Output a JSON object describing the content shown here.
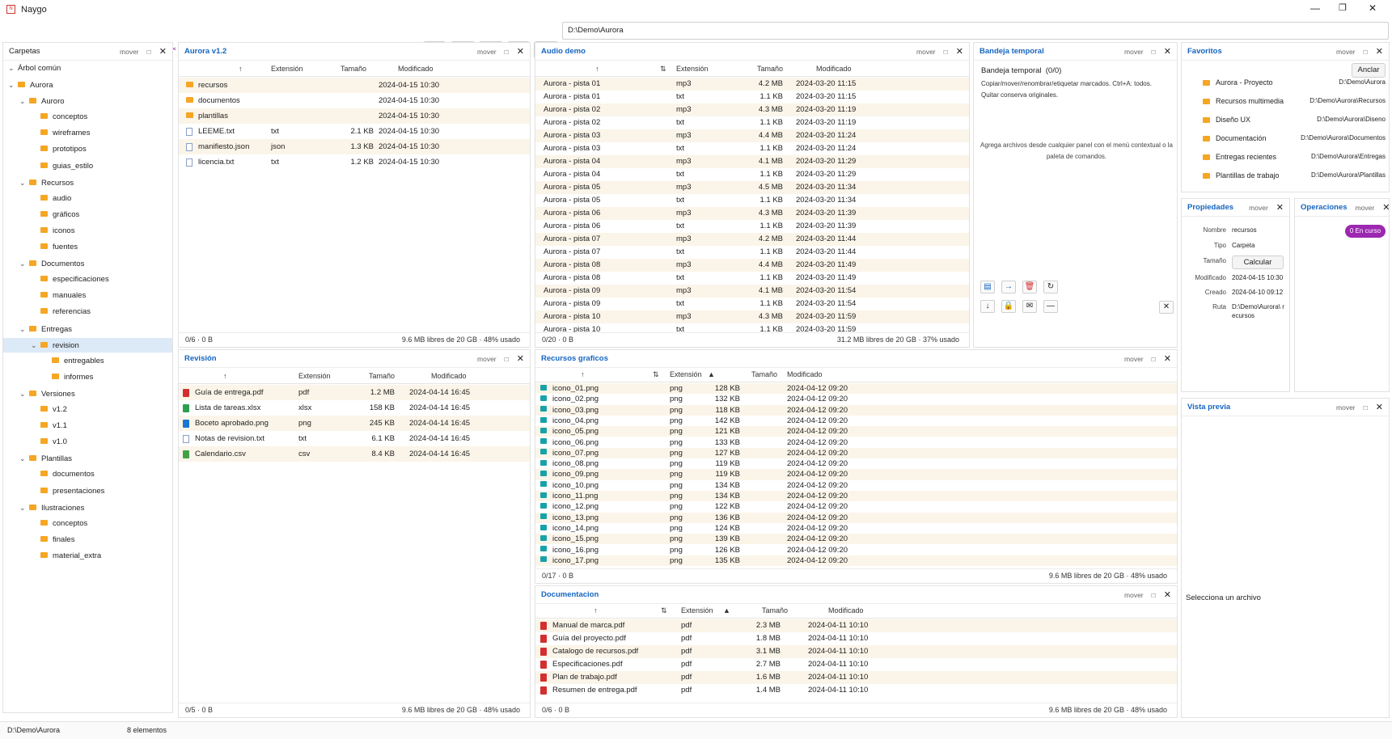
{
  "app": {
    "title": "Naygo"
  },
  "toolbar": {
    "path": "D:\\Demo\\Aurora"
  },
  "status": {
    "path": "D:\\Demo\\Aurora",
    "count": "8 elementos"
  },
  "pane_common": {
    "move": "mover",
    "restore": "□",
    "close": "✕"
  },
  "carpetas": {
    "title": "Carpetas",
    "tree_root": "Árbol común",
    "items": [
      {
        "label": "Aurora",
        "level": 0,
        "chev": "⌄"
      },
      {
        "label": "Auroro",
        "level": 1,
        "chev": "⌄"
      },
      {
        "label": "conceptos",
        "level": 2,
        "chev": ""
      },
      {
        "label": "wireframes",
        "level": 2,
        "chev": ""
      },
      {
        "label": "prototipos",
        "level": 2,
        "chev": ""
      },
      {
        "label": "guias_estilo",
        "level": 2,
        "chev": ""
      },
      {
        "label": "Recursos",
        "level": 1,
        "chev": "⌄"
      },
      {
        "label": "audio",
        "level": 2,
        "chev": ""
      },
      {
        "label": "gráficos",
        "level": 2,
        "chev": ""
      },
      {
        "label": "iconos",
        "level": 2,
        "chev": ""
      },
      {
        "label": "fuentes",
        "level": 2,
        "chev": ""
      },
      {
        "label": "Documentos",
        "level": 1,
        "chev": "⌄"
      },
      {
        "label": "especificaciones",
        "level": 2,
        "chev": ""
      },
      {
        "label": "manuales",
        "level": 2,
        "chev": ""
      },
      {
        "label": "referencias",
        "level": 2,
        "chev": ""
      },
      {
        "label": "Entregas",
        "level": 1,
        "chev": "⌄"
      },
      {
        "label": "revision",
        "level": 2,
        "chev": "⌄",
        "selected": true
      },
      {
        "label": "entregables",
        "level": 3,
        "chev": ""
      },
      {
        "label": "informes",
        "level": 3,
        "chev": ""
      },
      {
        "label": "Versiones",
        "level": 1,
        "chev": "⌄"
      },
      {
        "label": "v1.2",
        "level": 2,
        "chev": ""
      },
      {
        "label": "v1.1",
        "level": 2,
        "chev": ""
      },
      {
        "label": "v1.0",
        "level": 2,
        "chev": ""
      },
      {
        "label": "Plantillas",
        "level": 1,
        "chev": "⌄"
      },
      {
        "label": "documentos",
        "level": 2,
        "chev": ""
      },
      {
        "label": "presentaciones",
        "level": 2,
        "chev": ""
      },
      {
        "label": "Ilustraciones",
        "level": 1,
        "chev": "⌄"
      },
      {
        "label": "conceptos",
        "level": 2,
        "chev": ""
      },
      {
        "label": "finales",
        "level": 2,
        "chev": ""
      },
      {
        "label": "material_extra",
        "level": 2,
        "chev": ""
      }
    ]
  },
  "aurora": {
    "title": "Aurora v1.2",
    "cols": [
      "↑",
      "Extensión",
      "Tamaño",
      "Modificado"
    ],
    "rows": [
      {
        "icon": "folder",
        "name": "recursos",
        "ext": "",
        "size": "",
        "date": "2024-04-15 10:30"
      },
      {
        "icon": "folder",
        "name": "documentos",
        "ext": "",
        "size": "",
        "date": "2024-04-15 10:30"
      },
      {
        "icon": "folder",
        "name": "plantillas",
        "ext": "",
        "size": "",
        "date": "2024-04-15 10:30"
      },
      {
        "icon": "doc",
        "name": "LEEME.txt",
        "ext": "txt",
        "size": "2.1 KB",
        "date": "2024-04-15 10:30"
      },
      {
        "icon": "doc",
        "name": "manifiesto.json",
        "ext": "json",
        "size": "1.3 KB",
        "date": "2024-04-15 10:30"
      },
      {
        "icon": "doc",
        "name": "licencia.txt",
        "ext": "txt",
        "size": "1.2 KB",
        "date": "2024-04-15 10:30"
      }
    ],
    "foot_left": "0/6 · 0 B",
    "foot_right": "9.6 MB libres de 20 GB · 48% usado"
  },
  "audio": {
    "title": "Audio demo",
    "cols": [
      "↑",
      "⇅",
      "Extensión",
      "Tamaño",
      "Modificado"
    ],
    "rows": [
      {
        "name": "Aurora - pista 01",
        "ext": "mp3",
        "size": "4.2 MB",
        "date": "2024-03-20 11:15"
      },
      {
        "name": "Aurora - pista 01",
        "ext": "txt",
        "size": "1.1 KB",
        "date": "2024-03-20 11:15"
      },
      {
        "name": "Aurora - pista 02",
        "ext": "mp3",
        "size": "4.3 MB",
        "date": "2024-03-20 11:19"
      },
      {
        "name": "Aurora - pista 02",
        "ext": "txt",
        "size": "1.1 KB",
        "date": "2024-03-20 11:19"
      },
      {
        "name": "Aurora - pista 03",
        "ext": "mp3",
        "size": "4.4 MB",
        "date": "2024-03-20 11:24"
      },
      {
        "name": "Aurora - pista 03",
        "ext": "txt",
        "size": "1.1 KB",
        "date": "2024-03-20 11:24"
      },
      {
        "name": "Aurora - pista 04",
        "ext": "mp3",
        "size": "4.1 MB",
        "date": "2024-03-20 11:29"
      },
      {
        "name": "Aurora - pista 04",
        "ext": "txt",
        "size": "1.1 KB",
        "date": "2024-03-20 11:29"
      },
      {
        "name": "Aurora - pista 05",
        "ext": "mp3",
        "size": "4.5 MB",
        "date": "2024-03-20 11:34"
      },
      {
        "name": "Aurora - pista 05",
        "ext": "txt",
        "size": "1.1 KB",
        "date": "2024-03-20 11:34"
      },
      {
        "name": "Aurora - pista 06",
        "ext": "mp3",
        "size": "4.3 MB",
        "date": "2024-03-20 11:39"
      },
      {
        "name": "Aurora - pista 06",
        "ext": "txt",
        "size": "1.1 KB",
        "date": "2024-03-20 11:39"
      },
      {
        "name": "Aurora - pista 07",
        "ext": "mp3",
        "size": "4.2 MB",
        "date": "2024-03-20 11:44"
      },
      {
        "name": "Aurora - pista 07",
        "ext": "txt",
        "size": "1.1 KB",
        "date": "2024-03-20 11:44"
      },
      {
        "name": "Aurora - pista 08",
        "ext": "mp3",
        "size": "4.4 MB",
        "date": "2024-03-20 11:49"
      },
      {
        "name": "Aurora - pista 08",
        "ext": "txt",
        "size": "1.1 KB",
        "date": "2024-03-20 11:49"
      },
      {
        "name": "Aurora - pista 09",
        "ext": "mp3",
        "size": "4.1 MB",
        "date": "2024-03-20 11:54"
      },
      {
        "name": "Aurora - pista 09",
        "ext": "txt",
        "size": "1.1 KB",
        "date": "2024-03-20 11:54"
      },
      {
        "name": "Aurora - pista 10",
        "ext": "mp3",
        "size": "4.3 MB",
        "date": "2024-03-20 11:59"
      },
      {
        "name": "Aurora - pista 10",
        "ext": "txt",
        "size": "1.1 KB",
        "date": "2024-03-20 11:59"
      }
    ],
    "foot_left": "0/20 · 0 B",
    "foot_right": "31.2 MB libres de 20 GB · 37% usado"
  },
  "bandeja": {
    "title": "Bandeja temporal",
    "heading": "Bandeja temporal  (0/0)",
    "desc": "Copiar/mover/renombrar/etiquetar marcados. Ctrl+A: todos. Quitar conserva originales.",
    "empty": "Agrega archivos desde cualquier panel con el menú contextual o la paleta de comandos.",
    "buttons": [
      "▤",
      "→",
      "🗑",
      "↻",
      "↓",
      "🔒",
      "✉",
      "—"
    ],
    "close_btn": "✕"
  },
  "favoritos": {
    "title": "Favoritos",
    "pin": "Anclar",
    "items": [
      {
        "name": "Aurora - Proyecto",
        "path": "D:\\Demo\\Aurora"
      },
      {
        "name": "Recursos multimedia",
        "path": "D:\\Demo\\Aurora\\Recursos"
      },
      {
        "name": "Diseño UX",
        "path": "D:\\Demo\\Aurora\\Diseno"
      },
      {
        "name": "Documentación",
        "path": "D:\\Demo\\Aurora\\Documentos"
      },
      {
        "name": "Entregas recientes",
        "path": "D:\\Demo\\Aurora\\Entregas"
      },
      {
        "name": "Plantillas de trabajo",
        "path": "D:\\Demo\\Aurora\\Plantillas"
      }
    ]
  },
  "propiedades": {
    "title": "Propiedades",
    "rows": [
      {
        "label": "Nombre",
        "value": "recursos"
      },
      {
        "label": "Tipo",
        "value": "Carpeta"
      },
      {
        "label": "Tamaño",
        "value": ""
      },
      {
        "label": "Modificado",
        "value": "2024-04-15 10:30"
      },
      {
        "label": "Creado",
        "value": "2024-04-10 09:12"
      },
      {
        "label": "Ruta",
        "value": "D:\\Demo\\Aurora\\ recursos"
      }
    ],
    "calc": "Calcular"
  },
  "operaciones": {
    "title": "Operaciones",
    "badge": "0 En curso"
  },
  "revision": {
    "title": "Revisión",
    "cols": [
      "↑",
      "Extensión",
      "Tamaño",
      "Modificado"
    ],
    "rows": [
      {
        "icon": "pdf",
        "name": "Guía de entrega.pdf",
        "ext": "pdf",
        "size": "1.2 MB",
        "date": "2024-04-14 16:45"
      },
      {
        "icon": "xls",
        "name": "Lista de tareas.xlsx",
        "ext": "xlsx",
        "size": "158 KB",
        "date": "2024-04-14 16:45"
      },
      {
        "icon": "png",
        "name": "Boceto aprobado.png",
        "ext": "png",
        "size": "245 KB",
        "date": "2024-04-14 16:45"
      },
      {
        "icon": "doc",
        "name": "Notas de revision.txt",
        "ext": "txt",
        "size": "6.1 KB",
        "date": "2024-04-14 16:45"
      },
      {
        "icon": "csv",
        "name": "Calendario.csv",
        "ext": "csv",
        "size": "8.4 KB",
        "date": "2024-04-14 16:45"
      }
    ],
    "foot_left": "0/5 · 0 B",
    "foot_right": "9.6 MB libres de 20 GB · 48% usado"
  },
  "recursos": {
    "title": "Recursos graficos",
    "cols": [
      "↑",
      "⇅",
      "Extensión",
      "▲",
      "Tamaño",
      "Modificado"
    ],
    "rows": [
      {
        "name": "icono_01.png",
        "ext": "png",
        "size": "128 KB",
        "date": "2024-04-12 09:20"
      },
      {
        "name": "icono_02.png",
        "ext": "png",
        "size": "132 KB",
        "date": "2024-04-12 09:20"
      },
      {
        "name": "icono_03.png",
        "ext": "png",
        "size": "118 KB",
        "date": "2024-04-12 09:20"
      },
      {
        "name": "icono_04.png",
        "ext": "png",
        "size": "142 KB",
        "date": "2024-04-12 09:20"
      },
      {
        "name": "icono_05.png",
        "ext": "png",
        "size": "121 KB",
        "date": "2024-04-12 09:20"
      },
      {
        "name": "icono_06.png",
        "ext": "png",
        "size": "133 KB",
        "date": "2024-04-12 09:20"
      },
      {
        "name": "icono_07.png",
        "ext": "png",
        "size": "127 KB",
        "date": "2024-04-12 09:20"
      },
      {
        "name": "icono_08.png",
        "ext": "png",
        "size": "119 KB",
        "date": "2024-04-12 09:20"
      },
      {
        "name": "icono_09.png",
        "ext": "png",
        "size": "119 KB",
        "date": "2024-04-12 09:20"
      },
      {
        "name": "icono_10.png",
        "ext": "png",
        "size": "134 KB",
        "date": "2024-04-12 09:20"
      },
      {
        "name": "icono_11.png",
        "ext": "png",
        "size": "134 KB",
        "date": "2024-04-12 09:20"
      },
      {
        "name": "icono_12.png",
        "ext": "png",
        "size": "122 KB",
        "date": "2024-04-12 09:20"
      },
      {
        "name": "icono_13.png",
        "ext": "png",
        "size": "136 KB",
        "date": "2024-04-12 09:20"
      },
      {
        "name": "icono_14.png",
        "ext": "png",
        "size": "124 KB",
        "date": "2024-04-12 09:20"
      },
      {
        "name": "icono_15.png",
        "ext": "png",
        "size": "139 KB",
        "date": "2024-04-12 09:20"
      },
      {
        "name": "icono_16.png",
        "ext": "png",
        "size": "126 KB",
        "date": "2024-04-12 09:20"
      },
      {
        "name": "icono_17.png",
        "ext": "png",
        "size": "135 KB",
        "date": "2024-04-12 09:20"
      }
    ],
    "foot_left": "0/17 · 0 B",
    "foot_right": "9.6 MB libres de 20 GB · 48% usado"
  },
  "documentacion": {
    "title": "Documentacion",
    "cols": [
      "↑",
      "⇅",
      "Extensión",
      "▲",
      "Tamaño",
      "Modificado"
    ],
    "rows": [
      {
        "name": "Manual de marca.pdf",
        "ext": "pdf",
        "size": "2.3 MB",
        "date": "2024-04-11 10:10"
      },
      {
        "name": "Guía del proyecto.pdf",
        "ext": "pdf",
        "size": "1.8 MB",
        "date": "2024-04-11 10:10"
      },
      {
        "name": "Catalogo de recursos.pdf",
        "ext": "pdf",
        "size": "3.1 MB",
        "date": "2024-04-11 10:10"
      },
      {
        "name": "Especificaciones.pdf",
        "ext": "pdf",
        "size": "2.7 MB",
        "date": "2024-04-11 10:10"
      },
      {
        "name": "Plan de trabajo.pdf",
        "ext": "pdf",
        "size": "1.6 MB",
        "date": "2024-04-11 10:10"
      },
      {
        "name": "Resumen de entrega.pdf",
        "ext": "pdf",
        "size": "1.4 MB",
        "date": "2024-04-11 10:10"
      }
    ],
    "foot_left": "0/6 · 0 B",
    "foot_right": "9.6 MB libres de 20 GB · 48% usado"
  },
  "vista": {
    "title": "Vista previa",
    "empty": "Selecciona un archivo"
  },
  "colors": {
    "accent": "#1565c0",
    "folder": "#f5a623",
    "row_alt": "#fbf5e9",
    "selected": "#dce9f7",
    "badge": "#9c27b0"
  }
}
